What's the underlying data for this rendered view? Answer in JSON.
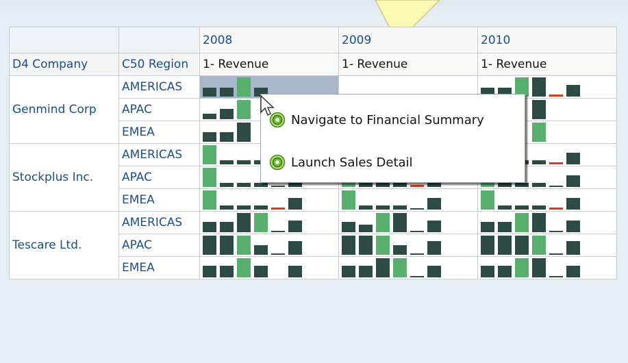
{
  "pivot": {
    "years": [
      "2008",
      "2009",
      "2010"
    ],
    "headers": {
      "company": "D4 Company",
      "region": "C50 Region"
    },
    "measures": [
      "1- Revenue",
      "1- Revenue",
      "1- Revenue"
    ],
    "rows": [
      {
        "company": "Genmind Corp",
        "region": "AMERICAS",
        "selected": true,
        "cells": [
          [
            {
              "h": 0.45,
              "c": "dark"
            },
            {
              "h": 0.45,
              "c": "dark"
            },
            {
              "h": 1.0,
              "c": "light"
            },
            {
              "h": 0.45,
              "c": "dark"
            }
          ],
          [],
          [
            {
              "h": 0.45,
              "c": "dark"
            },
            {
              "h": 0.45,
              "c": "dark"
            },
            {
              "h": 1.0,
              "c": "light"
            },
            {
              "h": 1.0,
              "c": "dark"
            },
            {
              "h": 0.1,
              "c": "neg"
            },
            {
              "h": 0.6,
              "c": "dark"
            }
          ]
        ]
      },
      {
        "company": "",
        "region": "APAC",
        "selected": false,
        "cells": [
          [
            {
              "h": 0.3,
              "c": "dark"
            },
            {
              "h": 0.55,
              "c": "dark"
            },
            {
              "h": 1.0,
              "c": "light"
            }
          ],
          [],
          [
            {
              "h": 1.0,
              "c": "dark"
            },
            {
              "h": 1.0,
              "c": "light"
            },
            {
              "h": 0.0,
              "c": "none"
            },
            {
              "h": 1.0,
              "c": "dark"
            }
          ]
        ]
      },
      {
        "company": "",
        "region": "EMEA",
        "selected": false,
        "cells": [
          [
            {
              "h": 0.5,
              "c": "dark"
            },
            {
              "h": 0.5,
              "c": "dark"
            },
            {
              "h": 1.0,
              "c": "dark"
            }
          ],
          [],
          [
            {
              "h": 1.0,
              "c": "dark"
            },
            {
              "h": 1.0,
              "c": "dark"
            },
            {
              "h": 0.0,
              "c": "none"
            },
            {
              "h": 1.0,
              "c": "light"
            }
          ]
        ]
      },
      {
        "company": "Stockplus Inc.",
        "region": "AMERICAS",
        "selected": false,
        "cells": [
          [
            {
              "h": 1.0,
              "c": "light"
            },
            {
              "h": 0.2,
              "c": "dark"
            },
            {
              "h": 0.2,
              "c": "dark"
            },
            {
              "h": 0.2,
              "c": "dark"
            },
            {
              "h": 0.1,
              "c": "neg"
            },
            {
              "h": 0.6,
              "c": "dark"
            }
          ],
          [
            {
              "h": 1.0,
              "c": "light"
            },
            {
              "h": 0.2,
              "c": "dark"
            },
            {
              "h": 0.2,
              "c": "dark"
            },
            {
              "h": 0.2,
              "c": "dark"
            },
            {
              "h": 0.1,
              "c": "neg"
            },
            {
              "h": 0.6,
              "c": "dark"
            }
          ],
          [
            {
              "h": 1.0,
              "c": "light"
            },
            {
              "h": 0.2,
              "c": "dark"
            },
            {
              "h": 0.2,
              "c": "dark"
            },
            {
              "h": 0.2,
              "c": "dark"
            },
            {
              "h": 0.1,
              "c": "neg"
            },
            {
              "h": 0.6,
              "c": "dark"
            }
          ]
        ]
      },
      {
        "company": "",
        "region": "APAC",
        "selected": false,
        "cells": [
          [
            {
              "h": 1.0,
              "c": "light"
            },
            {
              "h": 0.2,
              "c": "dark"
            },
            {
              "h": 0.2,
              "c": "dark"
            },
            {
              "h": 0.2,
              "c": "dark"
            },
            {
              "h": 0.08,
              "c": "dark"
            },
            {
              "h": 0.6,
              "c": "dark"
            }
          ],
          [
            {
              "h": 1.0,
              "c": "light"
            },
            {
              "h": 0.2,
              "c": "dark"
            },
            {
              "h": 0.2,
              "c": "dark"
            },
            {
              "h": 0.2,
              "c": "dark"
            },
            {
              "h": 0.1,
              "c": "neg"
            },
            {
              "h": 0.6,
              "c": "dark"
            }
          ],
          [
            {
              "h": 1.0,
              "c": "light"
            },
            {
              "h": 0.2,
              "c": "dark"
            },
            {
              "h": 0.2,
              "c": "dark"
            },
            {
              "h": 0.2,
              "c": "dark"
            },
            {
              "h": 0.08,
              "c": "dark"
            },
            {
              "h": 0.6,
              "c": "dark"
            }
          ]
        ]
      },
      {
        "company": "",
        "region": "EMEA",
        "selected": false,
        "cells": [
          [
            {
              "h": 1.0,
              "c": "light"
            },
            {
              "h": 0.2,
              "c": "dark"
            },
            {
              "h": 0.2,
              "c": "dark"
            },
            {
              "h": 0.2,
              "c": "dark"
            },
            {
              "h": 0.1,
              "c": "neg"
            },
            {
              "h": 0.6,
              "c": "dark"
            }
          ],
          [
            {
              "h": 1.0,
              "c": "light"
            },
            {
              "h": 0.2,
              "c": "dark"
            },
            {
              "h": 0.2,
              "c": "dark"
            },
            {
              "h": 0.2,
              "c": "dark"
            },
            {
              "h": 0.08,
              "c": "dark"
            },
            {
              "h": 0.6,
              "c": "dark"
            }
          ],
          [
            {
              "h": 1.0,
              "c": "light"
            },
            {
              "h": 0.2,
              "c": "dark"
            },
            {
              "h": 0.2,
              "c": "dark"
            },
            {
              "h": 0.2,
              "c": "dark"
            },
            {
              "h": 0.1,
              "c": "neg"
            },
            {
              "h": 0.6,
              "c": "dark"
            }
          ]
        ]
      },
      {
        "company": "Tescare Ltd.",
        "region": "AMERICAS",
        "selected": false,
        "cells": [
          [
            {
              "h": 0.55,
              "c": "dark"
            },
            {
              "h": 0.55,
              "c": "dark"
            },
            {
              "h": 1.0,
              "c": "dark"
            },
            {
              "h": 1.0,
              "c": "light"
            },
            {
              "h": 0.08,
              "c": "dark"
            },
            {
              "h": 0.6,
              "c": "dark"
            }
          ],
          [
            {
              "h": 0.55,
              "c": "dark"
            },
            {
              "h": 0.4,
              "c": "dark"
            },
            {
              "h": 1.0,
              "c": "light"
            },
            {
              "h": 1.0,
              "c": "dark"
            },
            {
              "h": 0.08,
              "c": "dark"
            },
            {
              "h": 0.6,
              "c": "dark"
            }
          ],
          [
            {
              "h": 0.55,
              "c": "dark"
            },
            {
              "h": 0.55,
              "c": "dark"
            },
            {
              "h": 1.0,
              "c": "light"
            },
            {
              "h": 1.0,
              "c": "dark"
            },
            {
              "h": 0.08,
              "c": "dark"
            },
            {
              "h": 0.6,
              "c": "dark"
            }
          ]
        ]
      },
      {
        "company": "",
        "region": "APAC",
        "selected": false,
        "cells": [
          [
            {
              "h": 1.0,
              "c": "dark"
            },
            {
              "h": 1.0,
              "c": "dark"
            },
            {
              "h": 1.0,
              "c": "light"
            },
            {
              "h": 0.5,
              "c": "dark"
            },
            {
              "h": 0.08,
              "c": "dark"
            },
            {
              "h": 0.7,
              "c": "dark"
            }
          ],
          [
            {
              "h": 1.0,
              "c": "dark"
            },
            {
              "h": 1.0,
              "c": "dark"
            },
            {
              "h": 1.0,
              "c": "light"
            },
            {
              "h": 0.5,
              "c": "dark"
            },
            {
              "h": 0.08,
              "c": "dark"
            },
            {
              "h": 0.7,
              "c": "dark"
            }
          ],
          [
            {
              "h": 1.0,
              "c": "dark"
            },
            {
              "h": 1.0,
              "c": "dark"
            },
            {
              "h": 1.0,
              "c": "dark"
            },
            {
              "h": 1.0,
              "c": "light"
            },
            {
              "h": 0.08,
              "c": "dark"
            },
            {
              "h": 0.7,
              "c": "dark"
            }
          ]
        ]
      },
      {
        "company": "",
        "region": "EMEA",
        "selected": false,
        "cells": [
          [
            {
              "h": 0.6,
              "c": "dark"
            },
            {
              "h": 0.6,
              "c": "dark"
            },
            {
              "h": 1.0,
              "c": "light"
            },
            {
              "h": 0.6,
              "c": "dark"
            },
            {
              "h": 0.0,
              "c": "none"
            },
            {
              "h": 0.6,
              "c": "dark"
            }
          ],
          [
            {
              "h": 0.6,
              "c": "dark"
            },
            {
              "h": 0.6,
              "c": "dark"
            },
            {
              "h": 1.0,
              "c": "dark"
            },
            {
              "h": 1.0,
              "c": "light"
            },
            {
              "h": 0.08,
              "c": "dark"
            },
            {
              "h": 0.6,
              "c": "dark"
            }
          ],
          [
            {
              "h": 0.6,
              "c": "dark"
            },
            {
              "h": 0.6,
              "c": "dark"
            },
            {
              "h": 1.0,
              "c": "light"
            },
            {
              "h": 1.0,
              "c": "dark"
            },
            {
              "h": 0.08,
              "c": "dark"
            },
            {
              "h": 0.6,
              "c": "dark"
            }
          ]
        ]
      }
    ]
  },
  "context_menu": {
    "items": [
      {
        "label": "Navigate to Financial Summary",
        "icon": "gear-icon"
      },
      {
        "label": "Launch Sales Detail",
        "icon": "gear-icon"
      }
    ]
  },
  "colors": {
    "bar_dark": "#2e4a44",
    "bar_light": "#59b06e",
    "bar_negative": "#d33d1d",
    "header_text": "#1c4e8c",
    "selection": "#a8b6cc",
    "callout": "#fafab4"
  }
}
